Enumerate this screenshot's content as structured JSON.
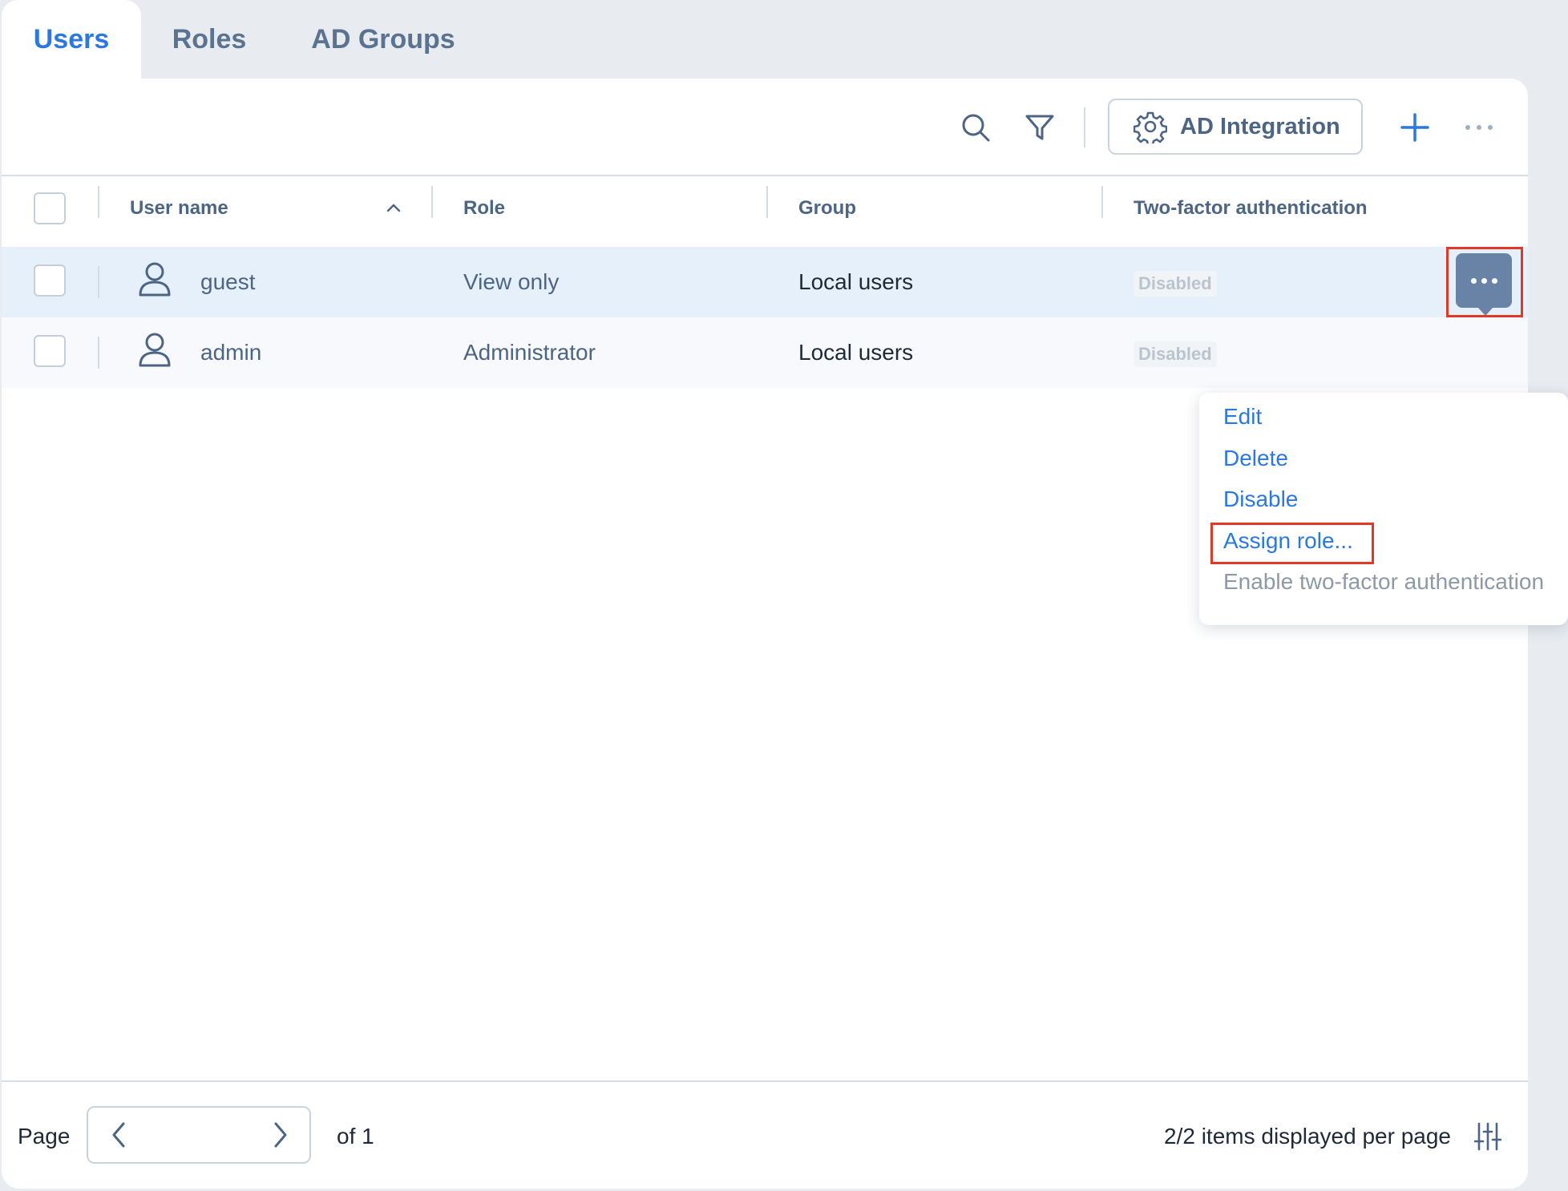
{
  "tabs": [
    {
      "label": "Users",
      "active": true
    },
    {
      "label": "Roles",
      "active": false
    },
    {
      "label": "AD Groups",
      "active": false
    }
  ],
  "toolbar": {
    "search_icon": "search-icon",
    "filter_icon": "filter-icon",
    "ad_integration_label": "AD Integration",
    "add_icon": "plus-icon",
    "more_icon": "more-horizontal-icon"
  },
  "table": {
    "columns": [
      "User name",
      "Role",
      "Group",
      "Two-factor authentication"
    ],
    "sort": {
      "column": "User name",
      "direction": "ascending"
    },
    "rows": [
      {
        "user_name": "guest",
        "role": "View only",
        "group": "Local users",
        "two_factor": "Disabled",
        "selected_highlight": true
      },
      {
        "user_name": "admin",
        "role": "Administrator",
        "group": "Local users",
        "two_factor": "Disabled",
        "selected_highlight": false
      }
    ]
  },
  "context_menu": {
    "items": [
      {
        "label": "Edit",
        "enabled": true
      },
      {
        "label": "Delete",
        "enabled": true
      },
      {
        "label": "Disable",
        "enabled": true
      },
      {
        "label": "Assign role...",
        "enabled": true,
        "highlighted": true
      },
      {
        "label": "Enable two-factor authentication",
        "enabled": false
      }
    ]
  },
  "footer": {
    "page_label": "Page",
    "of_label": "of 1",
    "items_label": "2/2 items displayed per page"
  },
  "colors": {
    "accent": "#2a78e0",
    "highlight_border": "#e03a26",
    "row_selected": "#e6f0fb"
  }
}
